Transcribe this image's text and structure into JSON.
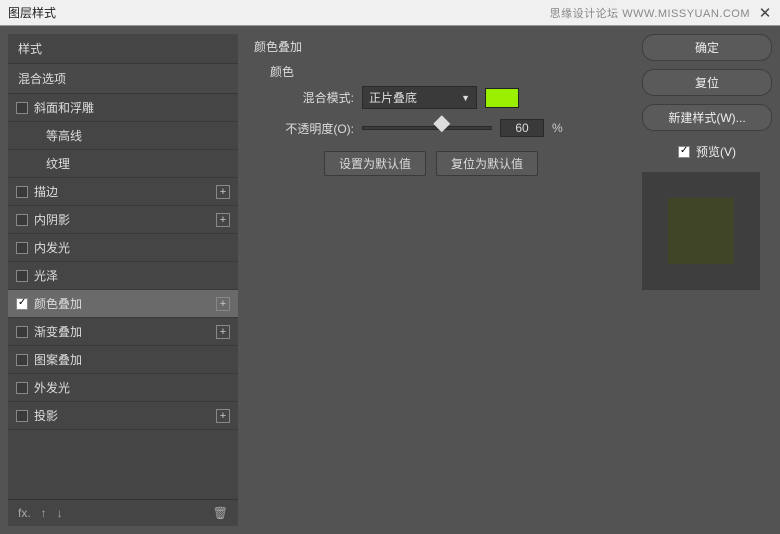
{
  "titlebar": {
    "title": "图层样式",
    "watermark": "思缘设计论坛  WWW.MISSYUAN.COM"
  },
  "sidebar": {
    "styles_header": "样式",
    "blending_header": "混合选项",
    "items": [
      {
        "label": "斜面和浮雕",
        "checked": false,
        "plus": false,
        "sub": false
      },
      {
        "label": "等高线",
        "checked": false,
        "plus": false,
        "sub": true
      },
      {
        "label": "纹理",
        "checked": false,
        "plus": false,
        "sub": true
      },
      {
        "label": "描边",
        "checked": false,
        "plus": true,
        "sub": false
      },
      {
        "label": "内阴影",
        "checked": false,
        "plus": true,
        "sub": false
      },
      {
        "label": "内发光",
        "checked": false,
        "plus": false,
        "sub": false
      },
      {
        "label": "光泽",
        "checked": false,
        "plus": false,
        "sub": false
      },
      {
        "label": "颜色叠加",
        "checked": true,
        "plus": true,
        "sub": false,
        "selected": true
      },
      {
        "label": "渐变叠加",
        "checked": false,
        "plus": true,
        "sub": false
      },
      {
        "label": "图案叠加",
        "checked": false,
        "plus": false,
        "sub": false
      },
      {
        "label": "外发光",
        "checked": false,
        "plus": false,
        "sub": false
      },
      {
        "label": "投影",
        "checked": false,
        "plus": true,
        "sub": false
      }
    ]
  },
  "main": {
    "section_title": "颜色叠加",
    "sub_title": "颜色",
    "blend_mode_label": "混合模式:",
    "blend_mode_value": "正片叠底",
    "opacity_label": "不透明度(O):",
    "opacity_value": "60",
    "opacity_unit": "%",
    "swatch_color": "#9aee00",
    "default_btn": "设置为默认值",
    "reset_btn": "复位为默认值"
  },
  "right": {
    "ok": "确定",
    "cancel": "复位",
    "new_style": "新建样式(W)...",
    "preview": "预览(V)"
  }
}
